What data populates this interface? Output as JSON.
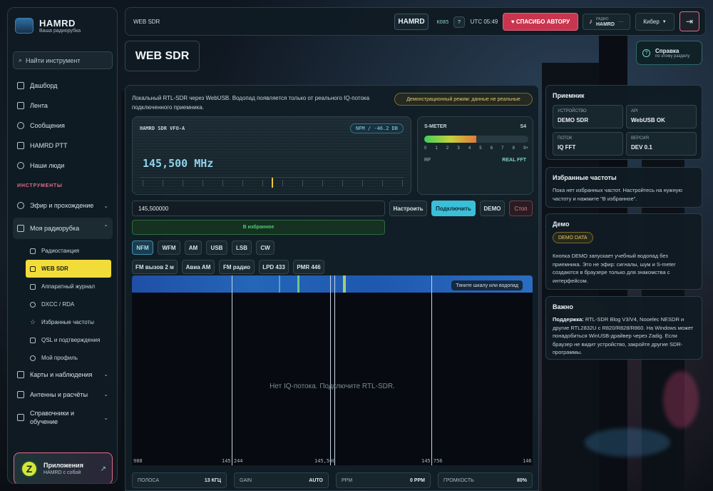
{
  "app": {
    "logo_title": "HAMRD",
    "logo_subtitle": "Ваша радиорубка"
  },
  "sidebar": {
    "search_placeholder": "Найти инструмент",
    "items": [
      {
        "label": "Дашборд",
        "icon": "layers-icon"
      },
      {
        "label": "Лента",
        "icon": "document-icon"
      },
      {
        "label": "Сообщения",
        "icon": "chat-icon"
      },
      {
        "label": "HAMRD PTT",
        "icon": "ptt-icon"
      },
      {
        "label": "Наши люди",
        "icon": "people-icon"
      }
    ],
    "section_tools": "ИНСТРУМЕНТЫ",
    "tool_groups": [
      {
        "label": "Эфир и прохождение",
        "icon": "wifi-icon"
      },
      {
        "label": "Моя радиорубка",
        "icon": "radio-icon"
      }
    ],
    "sub_items": [
      {
        "label": "Радиостанция",
        "icon": "radio-icon"
      },
      {
        "label": "WEB SDR",
        "icon": "sdr-icon"
      },
      {
        "label": "Аппаратный журнал",
        "icon": "logbook-icon"
      },
      {
        "label": "DXCC / RDA",
        "icon": "globe-icon"
      },
      {
        "label": "Избранные частоты",
        "icon": "star-icon"
      },
      {
        "label": "QSL и подтверждения",
        "icon": "mail-icon"
      },
      {
        "label": "Мой профиль",
        "icon": "user-icon"
      }
    ],
    "more_groups": [
      {
        "label": "Карты и наблюдения",
        "icon": "map-icon"
      },
      {
        "label": "Антенны и расчёты",
        "icon": "antenna-icon"
      },
      {
        "label": "Справочники и обучение",
        "icon": "book-icon"
      }
    ],
    "apps": {
      "title": "Приложения",
      "subtitle": "HAMRD с собой",
      "icon_letter": "Z"
    }
  },
  "topbar": {
    "title": "WEB SDR",
    "brand": "HAMRD",
    "locator": "KO85",
    "help_q": "?",
    "utc": "UTC 05:49",
    "thanks": "♥ СПАСИБО АВТОРУ",
    "radio_label": "РАДИО",
    "radio_name": "HAMRD",
    "theme": "Кибер"
  },
  "page": {
    "title": "WEB SDR",
    "help_title": "Справка",
    "help_sub": "по этому разделу"
  },
  "main": {
    "description": "Локальный RTL-SDR через WebUSB. Водопад появляется только от реального IQ-потока подключенного приемника.",
    "demo_warning": "Демонстрационный режим: данные не реальные",
    "vfo": {
      "label": "HAMRD SDR VFO-A",
      "mode": "NFM / -46.2 DB",
      "frequency": "145,500 MHz"
    },
    "smeter": {
      "label": "S-METER",
      "reading": "S4",
      "level": 0.5,
      "ticks": [
        "0",
        "1",
        "2",
        "3",
        "4",
        "5",
        "6",
        "7",
        "8",
        "9+"
      ],
      "rf": "RF",
      "fft": "REAL FFT"
    },
    "freq_input": "145,500000",
    "btn_tune": "Настроить",
    "btn_connect": "Подключить",
    "btn_demo": "DEMO",
    "btn_stop": "Стоп",
    "btn_fav": "В избранное",
    "modes": [
      "NFM",
      "WFM",
      "AM",
      "USB",
      "LSB",
      "CW"
    ],
    "presets": [
      "FM вызов 2 м",
      "Авиа AM",
      "FM радио",
      "LPD 433",
      "PMR 446"
    ],
    "waterfall_hint": "Тяните шкалу или водопад",
    "waterfall_msg": "Нет IQ-потока. Подключите RTL-SDR.",
    "scale": [
      "988",
      "145,244",
      "145,500",
      "145,756",
      "146"
    ],
    "stats": [
      {
        "k": "ПОЛОСА",
        "v": "13 КГЦ"
      },
      {
        "k": "GAIN",
        "v": "AUTO"
      },
      {
        "k": "PPM",
        "v": "0 PPM"
      },
      {
        "k": "ГРОМКОСТЬ",
        "v": "80%"
      }
    ]
  },
  "receiver": {
    "title": "Приемник",
    "cells": [
      {
        "k": "УСТРОЙСТВО",
        "v": "DEMO SDR"
      },
      {
        "k": "API",
        "v": "WebUSB OK"
      },
      {
        "k": "ПОТОК",
        "v": "IQ FFT"
      },
      {
        "k": "ВЕРСИЯ",
        "v": "DEV 0.1"
      }
    ]
  },
  "favorites": {
    "title": "Избранные частоты",
    "text": "Пока нет избранных частот. Настройтесь на нужную частоту и нажмите \"В избранное\"."
  },
  "demo": {
    "title": "Демо",
    "badge": "DEMO DATA",
    "text": "Кнопка DEMO запускает учебный водопад без приемника. Это не эфир: сигналы, шум и S-meter создаются в браузере только для знакомства с интерфейсом."
  },
  "important": {
    "title": "Важно",
    "strong": "Поддержка:",
    "text": " RTL-SDR Blog V3/V4, Nooelec NESDR и другие RTL2832U с R820/R828/R860. На Windows может понадобиться WinUSB-драйвер через Zadig. Если браузер не видит устройство, закройте другие SDR-программы."
  },
  "colors": {
    "accent": "#f2dc3a",
    "danger": "#c9354f",
    "cyan": "#3bbfd9"
  }
}
